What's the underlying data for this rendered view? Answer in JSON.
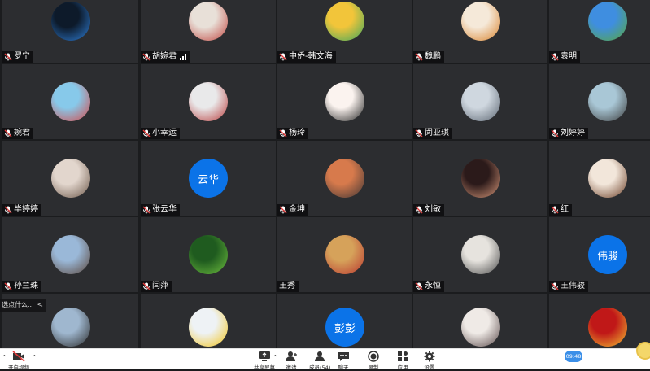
{
  "participants": [
    {
      "name": "罗宁",
      "avatar": "blue-swirl-logo",
      "colors": [
        "#0d1a2a",
        "#2f7fd8"
      ]
    },
    {
      "name": "胡婉君",
      "avatar": "photo-woman",
      "colors": [
        "#e8e0d8",
        "#c0453f"
      ],
      "signal": true
    },
    {
      "name": "中侨-韩文海",
      "avatar": "colorful-landscape",
      "colors": [
        "#f2c53a",
        "#3aa65e"
      ]
    },
    {
      "name": "魏鹏",
      "avatar": "tiger-cartoon",
      "colors": [
        "#f5e9d9",
        "#d9822b"
      ]
    },
    {
      "name": "袁明",
      "avatar": "green-field-sky",
      "colors": [
        "#3f8ee0",
        "#58a83c"
      ]
    },
    {
      "name": "婉君",
      "avatar": "watermelon-sky",
      "colors": [
        "#87c9ea",
        "#d84545"
      ]
    },
    {
      "name": "小幸运",
      "avatar": "snowman-toys",
      "colors": [
        "#e9e9ea",
        "#b83a3a"
      ]
    },
    {
      "name": "杨玲",
      "avatar": "cartoon-girl",
      "colors": [
        "#fbf3ef",
        "#222222"
      ]
    },
    {
      "name": "闵亚琪",
      "avatar": "snowy-road",
      "colors": [
        "#cfd7df",
        "#5a6470"
      ]
    },
    {
      "name": "刘婷婷",
      "avatar": "seaside-person",
      "colors": [
        "#a9c7d6",
        "#3b3b3b"
      ]
    },
    {
      "name": "毕婷婷",
      "avatar": "woman-portrait",
      "colors": [
        "#e2d6cd",
        "#6b5648"
      ]
    },
    {
      "name": "张云华",
      "avatar_text": "云华",
      "colors": [
        "#0b73e8",
        "#0b73e8"
      ]
    },
    {
      "name": "金坤",
      "avatar": "food-plate",
      "colors": [
        "#d77a4c",
        "#3d3535"
      ]
    },
    {
      "name": "刘敏",
      "avatar": "anime-girl",
      "colors": [
        "#2b1a1a",
        "#d8987a"
      ]
    },
    {
      "name": "红",
      "avatar": "anime-girl-brown",
      "colors": [
        "#f2e6da",
        "#6b3e26"
      ]
    },
    {
      "name": "孙兰珠",
      "avatar": "city-building",
      "colors": [
        "#9ab8d8",
        "#5a4438"
      ]
    },
    {
      "name": "闫萍",
      "avatar": "clover",
      "colors": [
        "#1f5b1f",
        "#6fbf3f"
      ]
    },
    {
      "name": "王秀",
      "avatar": "woman-red",
      "colors": [
        "#d6a25a",
        "#b8352f"
      ],
      "no_mic": true
    },
    {
      "name": "永恒",
      "avatar": "horse-art",
      "colors": [
        "#e6e3de",
        "#4a4a4a"
      ]
    },
    {
      "name": "王伟骏",
      "avatar_text": "伟骏",
      "colors": [
        "#0b73e8",
        "#0b73e8"
      ]
    },
    {
      "name": "",
      "avatar": "man-photo",
      "colors": [
        "#9fb7cf",
        "#2a2a2a"
      ]
    },
    {
      "name": "",
      "avatar": "tulips",
      "colors": [
        "#eef2f5",
        "#f2c41c"
      ]
    },
    {
      "name": "",
      "avatar_text": "彭彭",
      "colors": [
        "#0b73e8",
        "#0b73e8"
      ]
    },
    {
      "name": "",
      "avatar": "dancer",
      "colors": [
        "#efeae6",
        "#5a4a4a"
      ]
    },
    {
      "name": "",
      "avatar": "red-flag-person",
      "colors": [
        "#c01818",
        "#f2c232"
      ]
    }
  ],
  "toast": {
    "text": "选点什么...",
    "chevron": "<"
  },
  "toolbar": {
    "left": {
      "label": "开启视频",
      "icon": "video-off-icon"
    },
    "center": [
      {
        "label": "共享屏幕",
        "icon": "screen-share-icon"
      },
      {
        "label": "邀请",
        "icon": "invite-icon"
      },
      {
        "label": "成员(54)",
        "icon": "members-icon"
      },
      {
        "label": "聊天",
        "icon": "chat-icon"
      },
      {
        "label": "录制",
        "icon": "record-icon"
      },
      {
        "label": "应用",
        "icon": "apps-icon"
      },
      {
        "label": "设置",
        "icon": "settings-icon"
      }
    ],
    "time": "09:48"
  },
  "colors": {
    "tile_bg": "#2c2d30",
    "grid_gap": "#1b1c1e",
    "accent_blue": "#0b73e8",
    "toolbar_bg": "#ffffff"
  }
}
